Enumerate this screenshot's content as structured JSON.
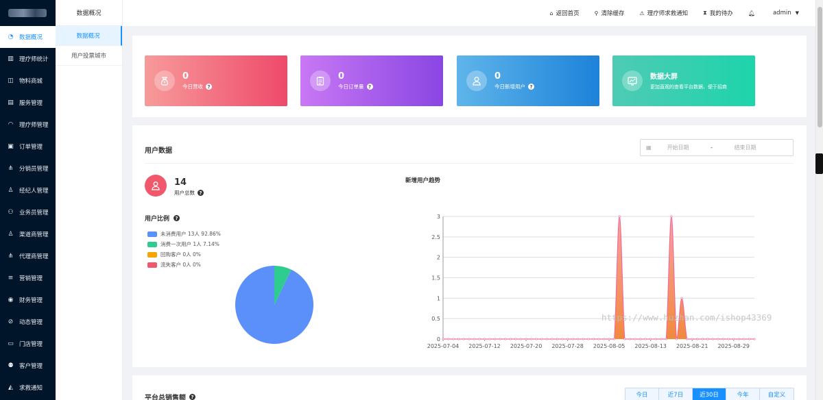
{
  "sidebar": {
    "items": [
      {
        "label": "数据概况",
        "icon": "pie-chart-icon",
        "active": true
      },
      {
        "label": "理疗师统计",
        "icon": "bar-chart-icon"
      },
      {
        "label": "物料商城",
        "icon": "bag-icon"
      },
      {
        "label": "服务管理",
        "icon": "service-icon"
      },
      {
        "label": "理疗师管理",
        "icon": "headset-icon"
      },
      {
        "label": "订单管理",
        "icon": "order-icon"
      },
      {
        "label": "分销员管理",
        "icon": "network-icon"
      },
      {
        "label": "经纪人管理",
        "icon": "user-icon"
      },
      {
        "label": "业务员管理",
        "icon": "users-icon"
      },
      {
        "label": "渠道商管理",
        "icon": "user-icon"
      },
      {
        "label": "代理商管理",
        "icon": "network-icon"
      },
      {
        "label": "营销管理",
        "icon": "marketing-icon"
      },
      {
        "label": "财务管理",
        "icon": "money-icon"
      },
      {
        "label": "动态管理",
        "icon": "compass-icon"
      },
      {
        "label": "门店管理",
        "icon": "store-icon"
      },
      {
        "label": "客户管理",
        "icon": "customer-icon"
      },
      {
        "label": "求救通知",
        "icon": "bell-icon"
      }
    ]
  },
  "subnav": {
    "title": "数据概况",
    "items": [
      {
        "label": "数据概况",
        "active": true
      },
      {
        "label": "用户投票城市"
      }
    ]
  },
  "header": {
    "home": "返回首页",
    "clear_cache": "清除缓存",
    "sos": "理疗师求救通知",
    "todo": "我的待办",
    "user": "admin"
  },
  "cards": [
    {
      "value": "0",
      "label": "今日营收",
      "color_from": "#f79a9a",
      "color_to": "#ee4a6a",
      "icon": "money-bag-icon"
    },
    {
      "value": "0",
      "label": "今日订单量",
      "color_from": "#c878f4",
      "color_to": "#8a46e3",
      "icon": "clipboard-icon"
    },
    {
      "value": "0",
      "label": "今日新增用户",
      "color_from": "#5fb5ea",
      "color_to": "#1d82d9",
      "icon": "user-add-icon"
    },
    {
      "title": "数据大屏",
      "desc": "更加直观的查看平台数据、便于招商",
      "color_from": "#4fcbb5",
      "color_to": "#1dd4ab",
      "icon": "monitor-chart-icon"
    }
  ],
  "user_data": {
    "title": "用户数据",
    "start_placeholder": "开始日期",
    "end_placeholder": "结束日期",
    "separator": "-",
    "total": "14",
    "total_label": "用户总数",
    "ratio_title": "用户比例",
    "trend_title": "新增用户趋势",
    "legend": [
      {
        "text": "未消费用户  13人  92.86%",
        "color": "#5b8ff9"
      },
      {
        "text": "消费一次用户  1人  7.14%",
        "color": "#2ecc8f"
      },
      {
        "text": "回购客户  0人  0%",
        "color": "#f7a500"
      },
      {
        "text": "流失客户  0人  0%",
        "color": "#f0596b"
      }
    ]
  },
  "sales": {
    "title": "平台总销售额",
    "tabs": [
      "今日",
      "近7日",
      "近30日",
      "今年",
      "自定义"
    ],
    "active_tab": 2
  },
  "watermark": "https://www.huzhan.com/ishop43369",
  "chart_data": [
    {
      "type": "pie",
      "title": "用户比例",
      "categories": [
        "未消费用户",
        "消费一次用户",
        "回购客户",
        "流失客户"
      ],
      "values": [
        13,
        1,
        0,
        0
      ],
      "colors": [
        "#5b8ff9",
        "#2ecc8f",
        "#f7a500",
        "#f0596b"
      ]
    },
    {
      "type": "area",
      "title": "新增用户趋势",
      "ylim": [
        0,
        3
      ],
      "yticks": [
        "0",
        "0.5",
        "1",
        "1.5",
        "2",
        "2.5",
        "3"
      ],
      "xticks": [
        "2025-07-04",
        "2025-07-12",
        "2025-07-20",
        "2025-07-28",
        "2025-08-05",
        "2025-08-13",
        "2025-08-21",
        "2025-08-29"
      ],
      "x_start": "2025-07-04",
      "x_end": "2025-09-02",
      "series": [
        {
          "color": "#f08a5d",
          "points": [
            {
              "x": "2025-08-07",
              "y": 3
            },
            {
              "x": "2025-08-17",
              "y": 3
            },
            {
              "x": "2025-08-19",
              "y": 1
            }
          ]
        }
      ]
    }
  ]
}
